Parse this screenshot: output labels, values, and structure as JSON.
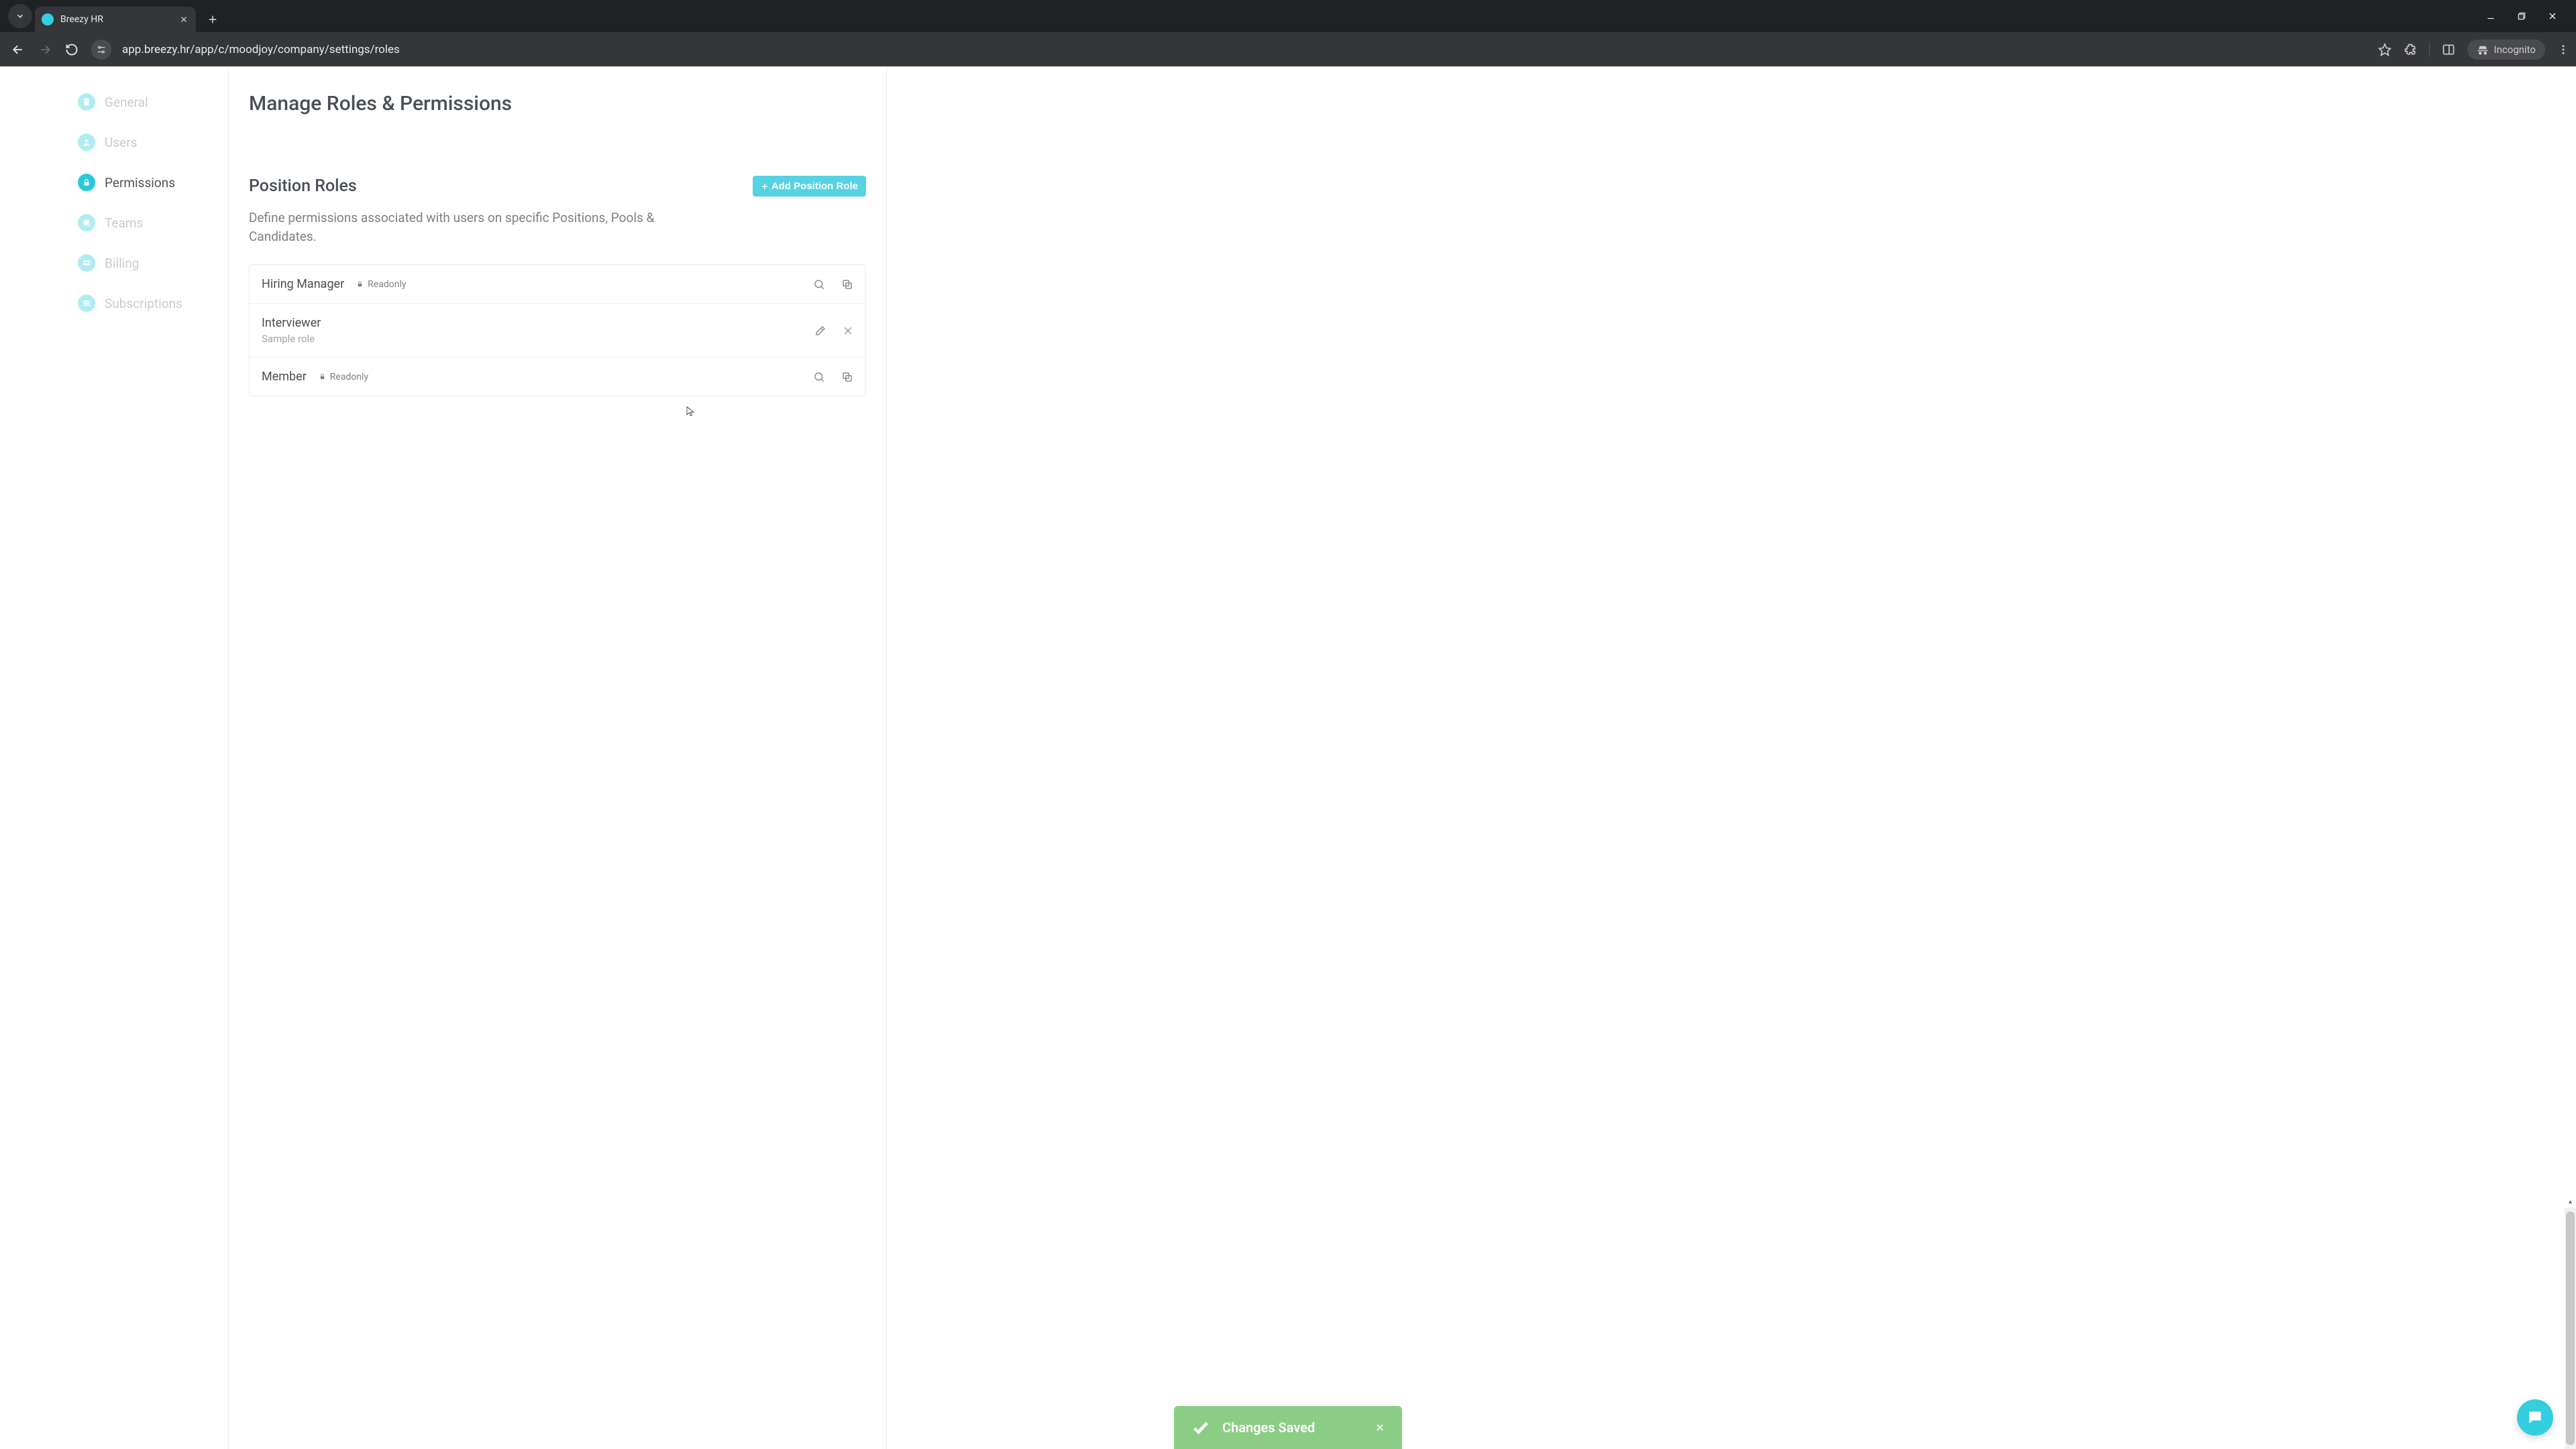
{
  "browser": {
    "tab_title": "Breezy HR",
    "url": "app.breezy.hr/app/c/moodjoy/company/settings/roles",
    "incognito_label": "Incognito"
  },
  "sidebar": {
    "items": [
      {
        "label": "General",
        "icon": "building-icon",
        "active": false
      },
      {
        "label": "Users",
        "icon": "user-icon",
        "active": false
      },
      {
        "label": "Permissions",
        "icon": "lock-icon",
        "active": true
      },
      {
        "label": "Teams",
        "icon": "x-burst-icon",
        "active": false
      },
      {
        "label": "Billing",
        "icon": "card-icon",
        "active": false
      },
      {
        "label": "Subscriptions",
        "icon": "bars-icon",
        "active": false
      }
    ]
  },
  "page": {
    "title": "Manage Roles & Permissions",
    "section_title": "Position Roles",
    "section_desc": "Define permissions associated with users on specific Positions, Pools & Candidates.",
    "add_button": "Add Position Role",
    "readonly_label": "Readonly",
    "roles": [
      {
        "name": "Hiring Manager",
        "readonly": true,
        "subtitle": ""
      },
      {
        "name": "Interviewer",
        "readonly": false,
        "subtitle": "Sample role"
      },
      {
        "name": "Member",
        "readonly": true,
        "subtitle": ""
      }
    ]
  },
  "toast": {
    "message": "Changes Saved"
  }
}
